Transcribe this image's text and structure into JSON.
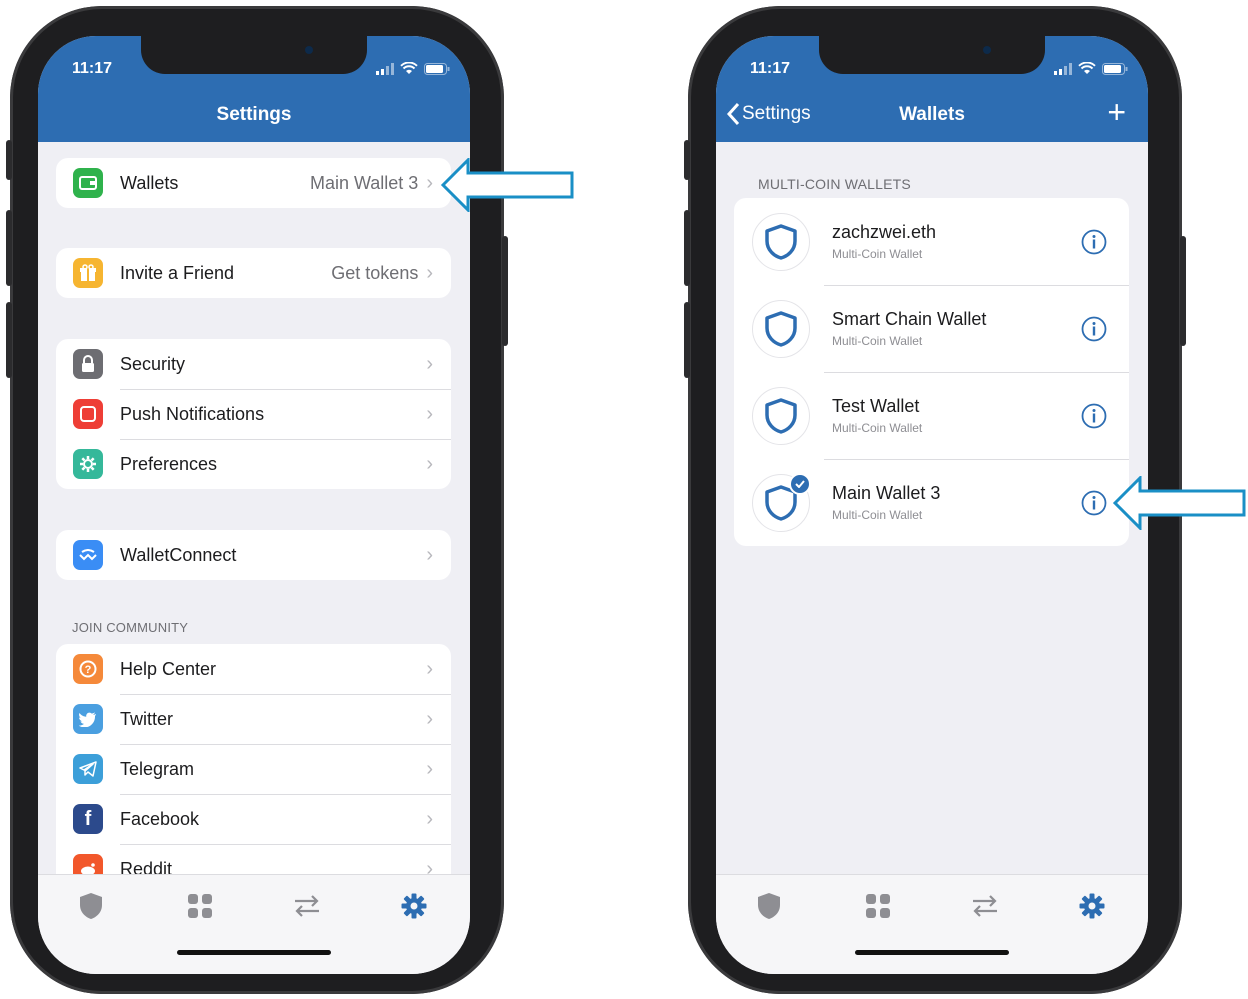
{
  "colors": {
    "header": "#2d6db2",
    "accent": "#2d6db2",
    "arrow": "#1a8fc6"
  },
  "left_screen": {
    "status_time": "11:17",
    "title": "Settings",
    "groups": [
      [
        {
          "label": "Wallets",
          "detail": "Main Wallet 3",
          "icon": "wallet-icon",
          "color": "#2fb24c"
        }
      ],
      [
        {
          "label": "Invite a Friend",
          "detail": "Get tokens",
          "icon": "gift-icon",
          "color": "#f6b531"
        }
      ],
      [
        {
          "label": "Security",
          "detail": "",
          "icon": "lock-icon",
          "color": "#6d6d72"
        },
        {
          "label": "Push Notifications",
          "detail": "",
          "icon": "bell-icon",
          "color": "#ee3e36"
        },
        {
          "label": "Preferences",
          "detail": "",
          "icon": "gear-icon",
          "color": "#35b89a"
        }
      ],
      [
        {
          "label": "WalletConnect",
          "detail": "",
          "icon": "walletconnect-icon",
          "color": "#3a8df5"
        }
      ]
    ],
    "community_label": "JOIN COMMUNITY",
    "community": [
      {
        "label": "Help Center",
        "icon": "help-icon",
        "color": "#f5893a"
      },
      {
        "label": "Twitter",
        "icon": "twitter-icon",
        "color": "#4a9fe0"
      },
      {
        "label": "Telegram",
        "icon": "telegram-icon",
        "color": "#3c9fd9"
      },
      {
        "label": "Facebook",
        "icon": "facebook-icon",
        "color": "#2c4a8c"
      },
      {
        "label": "Reddit",
        "icon": "reddit-icon",
        "color": "#f2572b"
      }
    ],
    "tabs": [
      "shield-icon",
      "apps-icon",
      "swap-icon",
      "settings-icon"
    ],
    "active_tab": "settings-icon"
  },
  "right_screen": {
    "status_time": "11:17",
    "back_label": "Settings",
    "title": "Wallets",
    "add_symbol": "+",
    "section_label": "MULTI-COIN WALLETS",
    "wallets": [
      {
        "name": "zachzwei.eth",
        "type": "Multi-Coin Wallet",
        "selected": false
      },
      {
        "name": "Smart Chain Wallet",
        "type": "Multi-Coin Wallet",
        "selected": false
      },
      {
        "name": "Test Wallet",
        "type": "Multi-Coin Wallet",
        "selected": false
      },
      {
        "name": "Main Wallet 3",
        "type": "Multi-Coin Wallet",
        "selected": true
      }
    ],
    "tabs": [
      "shield-icon",
      "apps-icon",
      "swap-icon",
      "settings-icon"
    ],
    "active_tab": "settings-icon"
  }
}
